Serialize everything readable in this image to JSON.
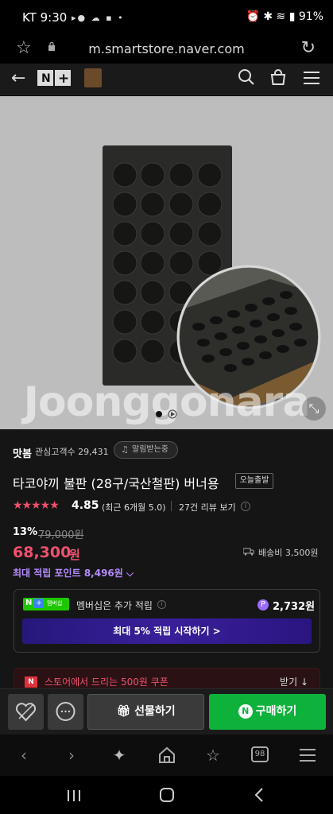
{
  "status": {
    "time": "KT 9:30",
    "notif_icons": "▸● ☁ ▪ •",
    "right": "⏰ ✱ ≋ ▮ 91%"
  },
  "browser": {
    "url": "m.smartstore.naver.com"
  },
  "hero": {
    "watermark": "Joonggonara",
    "page_indicator": 1
  },
  "store": {
    "name": "맛봄",
    "fans": "관심고객수 29,431",
    "alarm_label": "알림받는중"
  },
  "product": {
    "title": "타코야끼 불판 (28구/국산철판) 버너용",
    "badge": "오늘출발",
    "stars": "★★★★★",
    "rating": "4.85",
    "rating_note": "(최근 6개월 5.0)",
    "reviews": "27건 리뷰 보기",
    "discount": "13%",
    "original_price": "79,000원",
    "price": "68,300",
    "price_unit": "원",
    "shipping": "배송비 3,500원",
    "points": "최대 적립 포인트 8,496원"
  },
  "membership": {
    "tag_n": "N",
    "tag_plus": "+",
    "tag_text": "멤버십",
    "text": "멤버십은 추가 적립",
    "coin": "P",
    "points": "2,732원",
    "button": "최대 5% 적립 시작하기 >"
  },
  "coupon": {
    "text": "스토어에서 드리는 500원 쿠폰",
    "action": "받기 ↓"
  },
  "actions": {
    "gift": "선물하기",
    "buy": "구매하기",
    "buy_logo": "N"
  },
  "browser_toolbar": {
    "tabs_count": "98"
  },
  "colors": {
    "accent_pink": "#f0506e",
    "naver_green": "#0eb23b",
    "points_purple": "#b48cff"
  }
}
